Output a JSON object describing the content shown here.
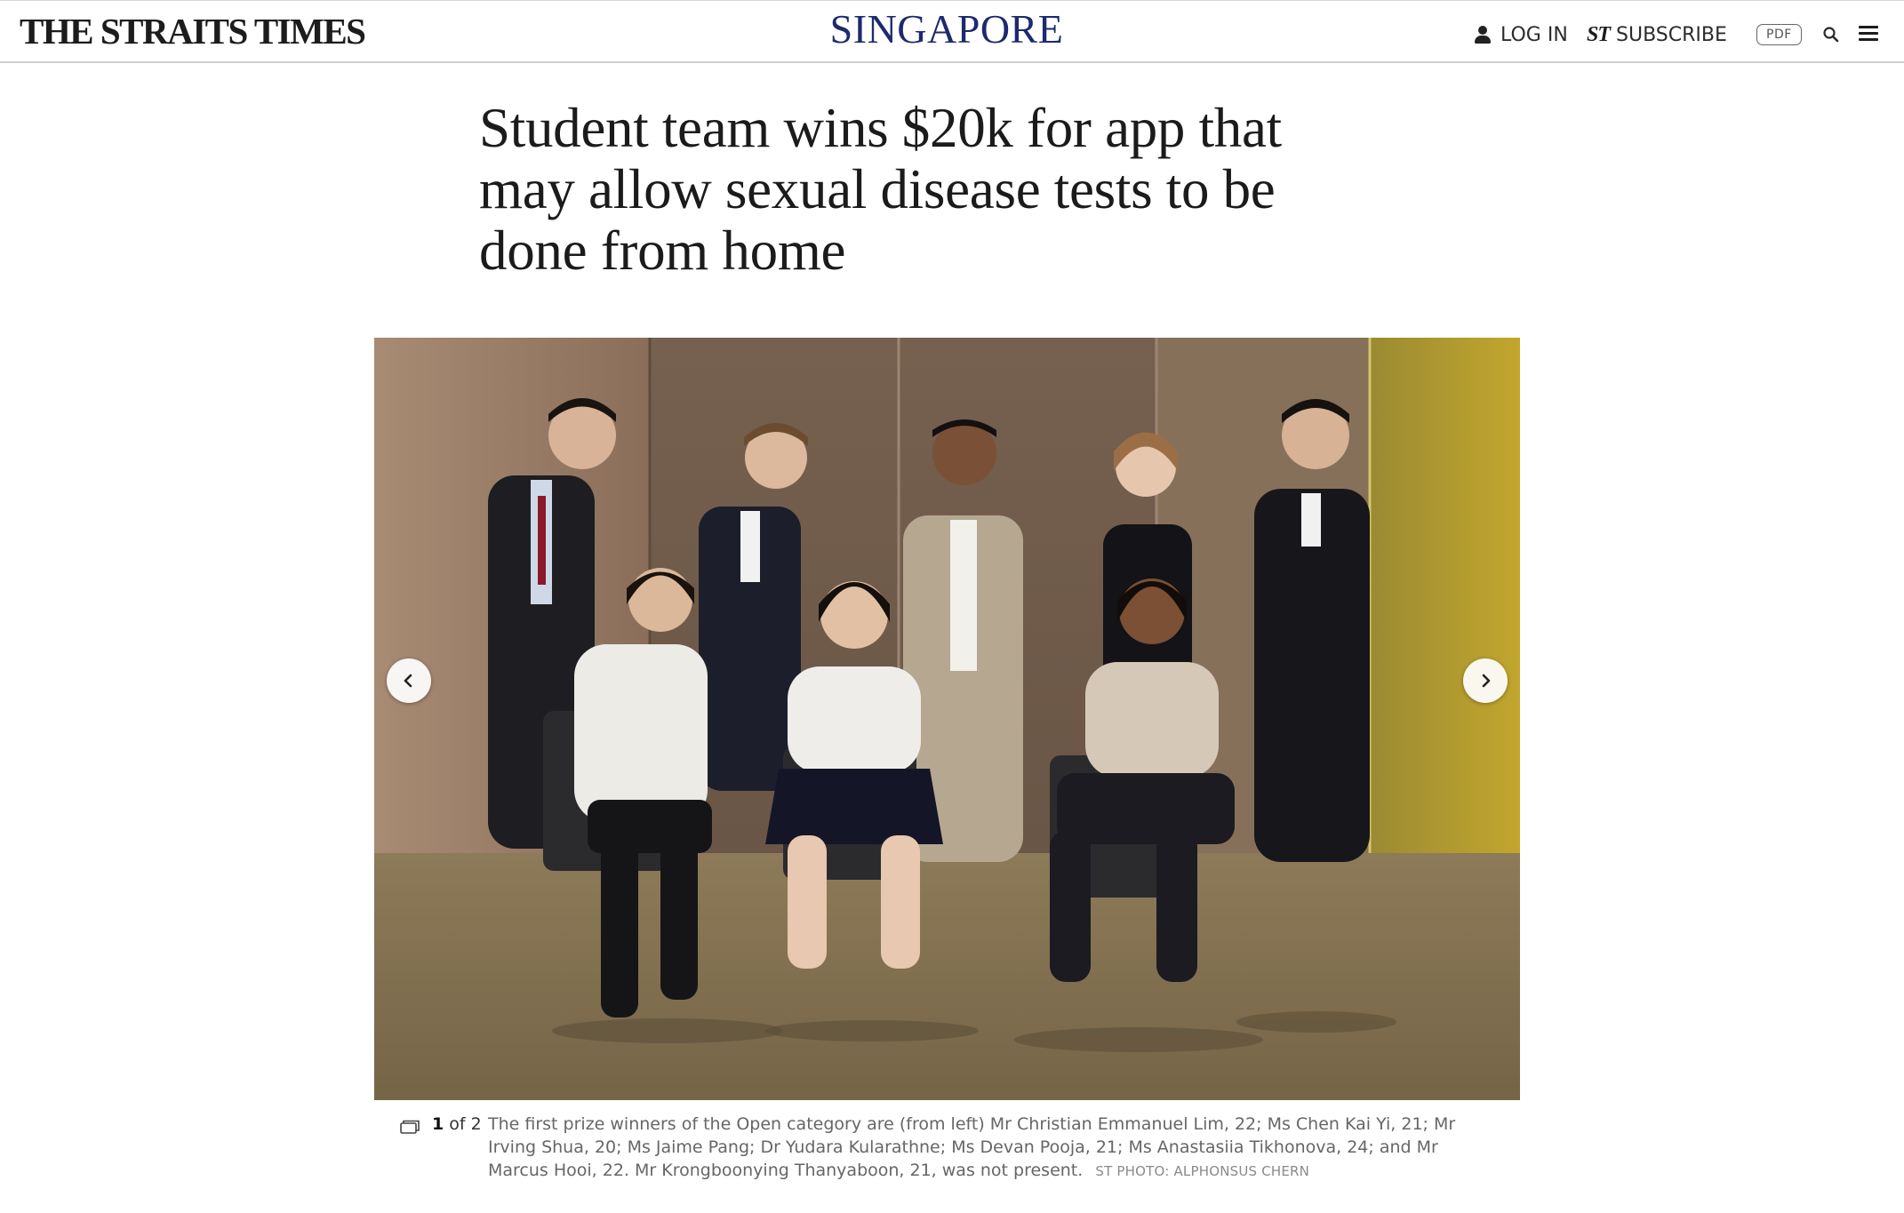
{
  "header": {
    "logo": "THE STRAITS TIMES",
    "section": "SINGAPORE",
    "login_label": "LOG IN",
    "subscribe_icon": "ST",
    "subscribe_label": "SUBSCRIBE",
    "pdf_label": "PDF",
    "icons": {
      "user": "user-icon",
      "search": "search-icon",
      "menu": "hamburger-menu-icon"
    }
  },
  "article": {
    "headline": "Student team wins $20k for app that may allow sexual disease tests to be done from home"
  },
  "gallery": {
    "current": "1",
    "of_label": "of 2",
    "caption": "The first prize winners of the Open category are (from left) Mr Christian Emmanuel Lim, 22; Ms Chen Kai Yi, 21; Mr Irving Shua, 20; Ms Jaime Pang; Dr Yudara Kularathne; Ms Devan Pooja, 21; Ms Anastasiia Tikhonova, 24; and Mr Marcus Hooi, 22. Mr Krongboonying Thanyaboon, 21, was not present.",
    "credit": "ST PHOTO: ALPHONSUS CHERN",
    "prev_icon": "chevron-left-icon",
    "next_icon": "chevron-right-icon"
  },
  "colors": {
    "section_title": "#1d2a6e",
    "headline": "#1b1b1b",
    "caption": "#666666"
  }
}
